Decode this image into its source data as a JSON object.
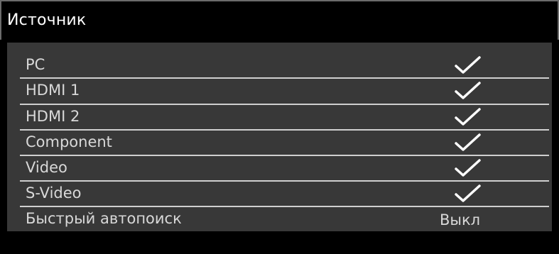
{
  "window": {
    "title": "Источник"
  },
  "sources": [
    {
      "label": "PC",
      "enabled": true
    },
    {
      "label": "HDMI 1",
      "enabled": true
    },
    {
      "label": "HDMI 2",
      "enabled": true
    },
    {
      "label": "Component",
      "enabled": true
    },
    {
      "label": "Video",
      "enabled": true
    },
    {
      "label": "S-Video",
      "enabled": true
    }
  ],
  "quick_search": {
    "label": "Быстрый автопоиск",
    "value": "Выкл"
  },
  "colors": {
    "background": "#000000",
    "panel": "#383838",
    "text": "#d8d8d8",
    "title_text": "#ffffff",
    "divider": "#cfcfcf",
    "frame": "#6b6b6b"
  },
  "icons": {
    "check": "checkmark-icon"
  }
}
